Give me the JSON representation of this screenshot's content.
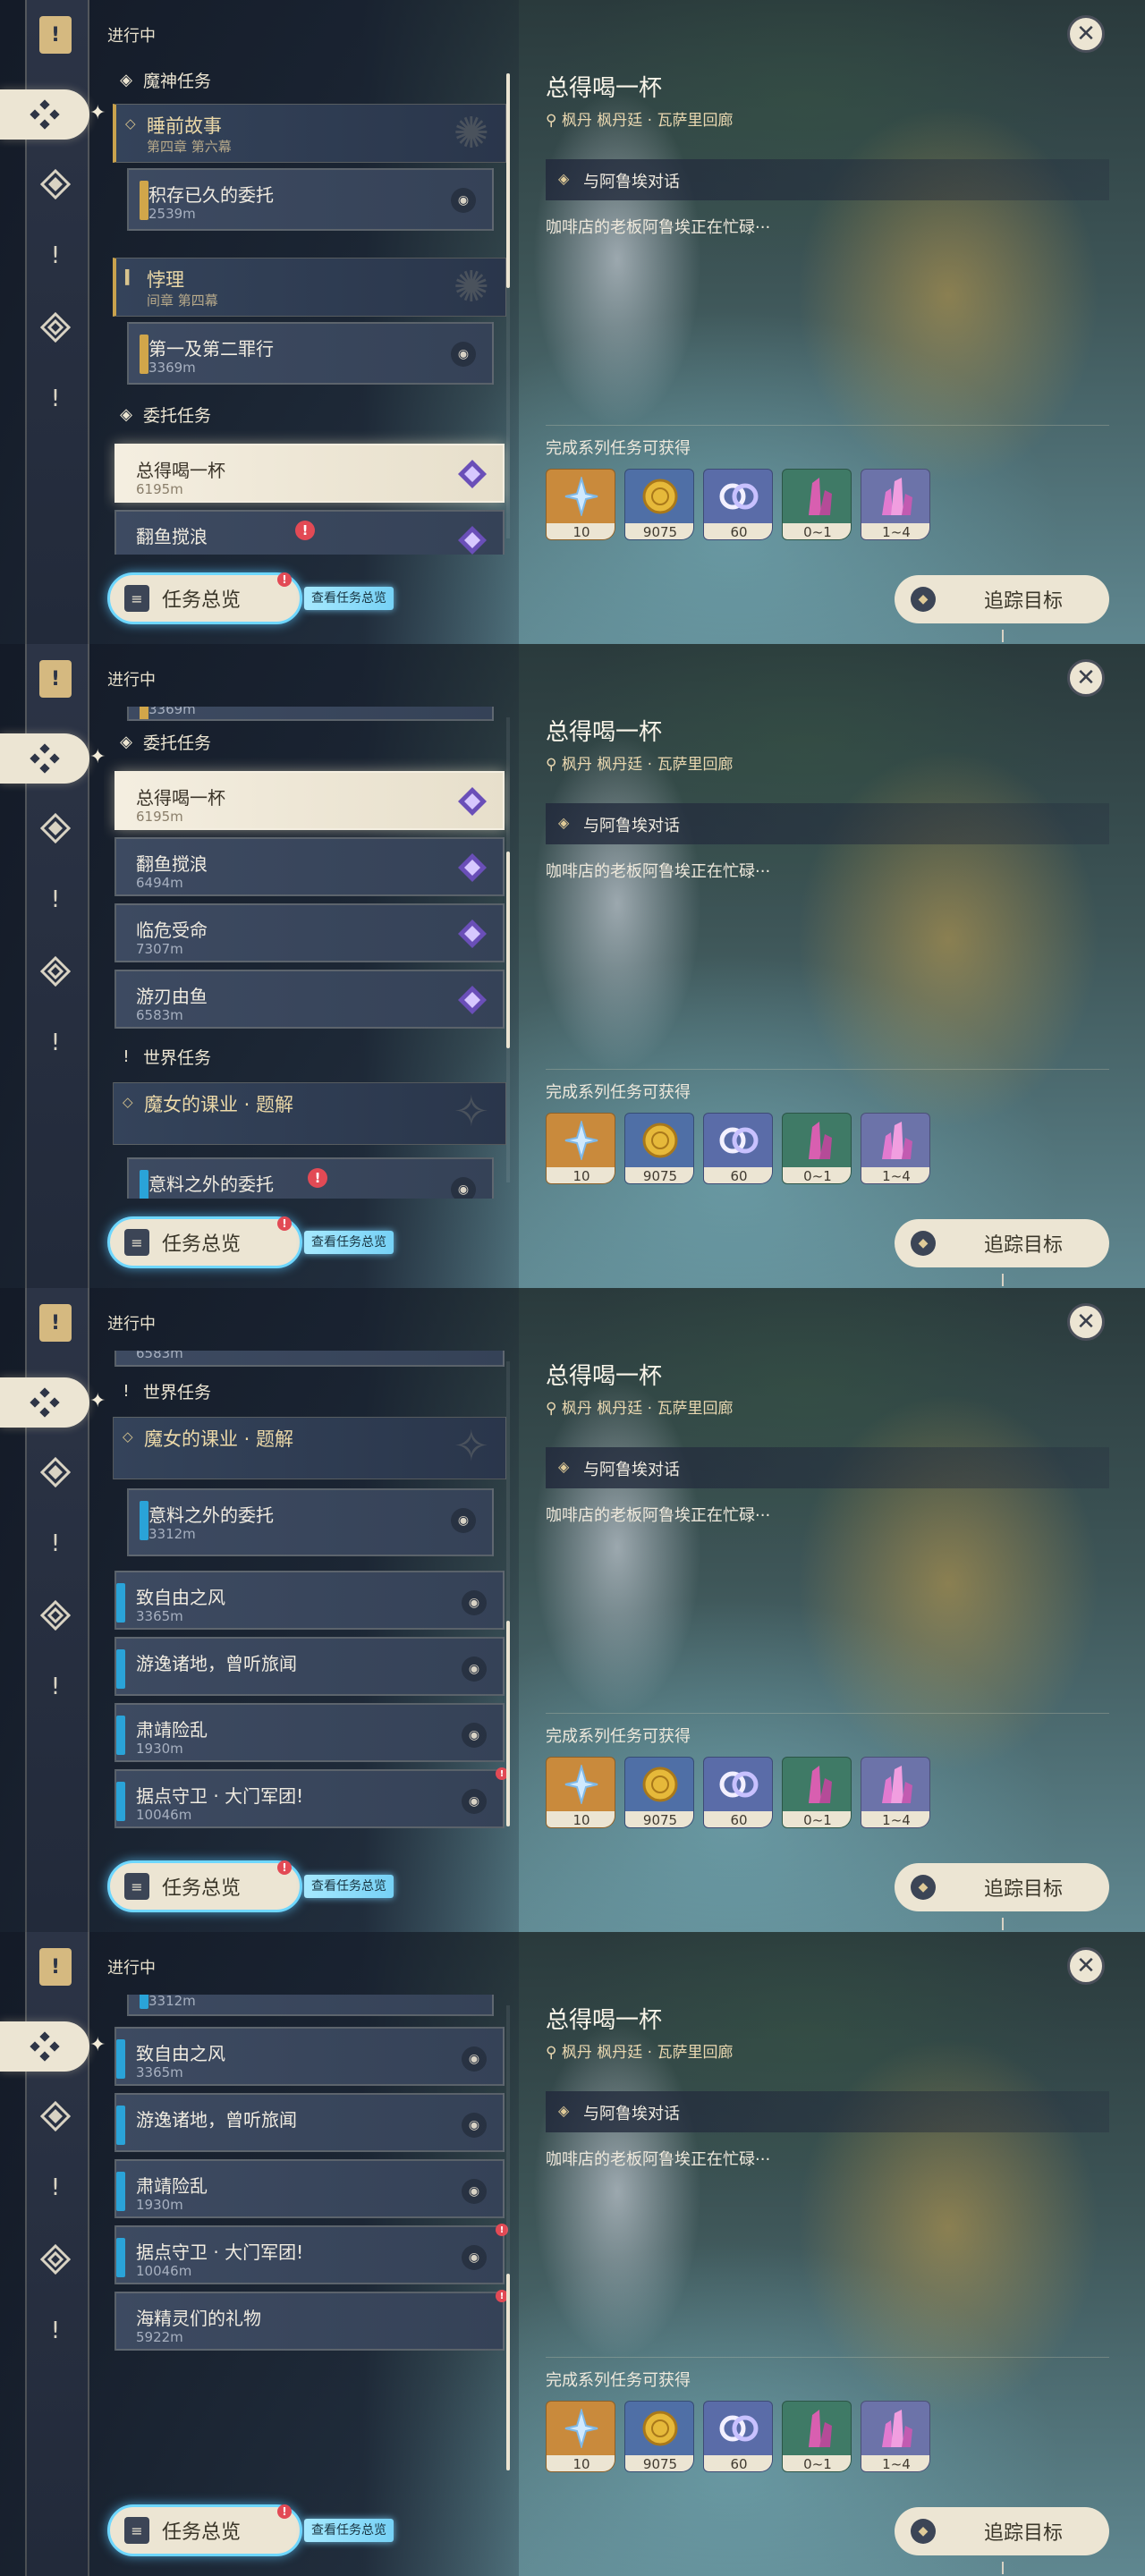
{
  "header": {
    "status": "进行中"
  },
  "sections": {
    "archon": "魔神任务",
    "commission": "委托任务",
    "world": "世界任务"
  },
  "chapters": [
    {
      "title": "睡前故事",
      "subtitle": "第四章 第六幕"
    },
    {
      "title": "悖理",
      "subtitle": "间章 第四幕"
    },
    {
      "title": "魔女的课业 · 题解",
      "subtitle": ""
    }
  ],
  "quests": {
    "stockpiled": {
      "name": "积存已久的委托",
      "distance": "2539m"
    },
    "first_second_sin": {
      "name": "第一及第二罪行",
      "distance": "3369m"
    },
    "drink": {
      "name": "总得喝一杯",
      "distance": "6195m"
    },
    "fish_stir": {
      "name": "翻鱼搅浪",
      "distance": "6494m"
    },
    "danger": {
      "name": "临危受命",
      "distance": "7307m"
    },
    "blade_fish": {
      "name": "游刃由鱼",
      "distance": "6583m"
    },
    "unexpected": {
      "name": "意料之外的委托",
      "distance": "3312m"
    },
    "free_wind": {
      "name": "致自由之风",
      "distance": "3365m"
    },
    "wander": {
      "name": "游逸诸地，曾听旅闻",
      "distance": ""
    },
    "suppress": {
      "name": "肃靖险乱",
      "distance": "1930m"
    },
    "stronghold": {
      "name": "据点守卫 · 大门军团!",
      "distance": "10046m"
    },
    "sea_gift": {
      "name": "海精灵们的礼物",
      "distance": "5922m"
    }
  },
  "detail": {
    "title": "总得喝一杯",
    "location": "枫丹 枫丹廷 · 瓦萨里回廊",
    "objective": "与阿鲁埃对话",
    "description": "咖啡店的老板阿鲁埃正在忙碌···",
    "rewards_label": "完成系列任务可获得",
    "rewards": [
      {
        "icon": "adventure-exp-icon",
        "count": "10",
        "color": "#c98a3c"
      },
      {
        "icon": "mora-coin-icon",
        "count": "9075",
        "color": "#4f6fa6"
      },
      {
        "icon": "companionship-exp-icon",
        "count": "60",
        "color": "#5a6ca8"
      },
      {
        "icon": "crystal-ore-icon",
        "count": "0~1",
        "color": "#3f7a66"
      },
      {
        "icon": "enhancement-crystal-icon",
        "count": "1~4",
        "color": "#6c73a9"
      }
    ]
  },
  "buttons": {
    "overview": "任务总览",
    "overview_link": "查看任务总览",
    "overview_badge": "!",
    "track": "追踪目标",
    "close": "✕"
  }
}
